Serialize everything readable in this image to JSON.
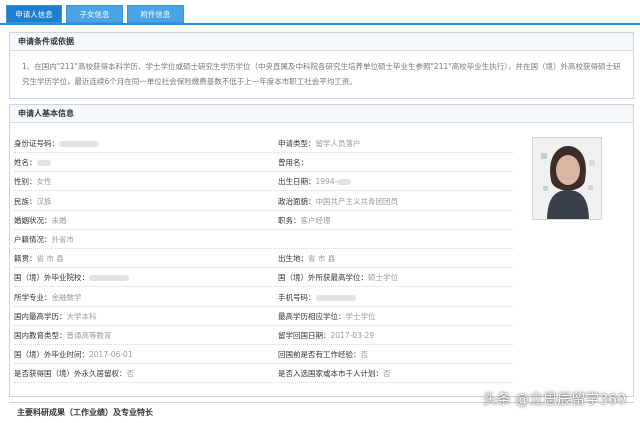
{
  "tabs": [
    {
      "label": "申请人信息"
    },
    {
      "label": "子女信息"
    },
    {
      "label": "附件信息"
    }
  ],
  "conditions": {
    "title": "申请条件或依据",
    "text": "1、在国内\"211\"高校获得本科学历、学士学位或硕士研究生学历学位（中央直属及中科院各研究生培养单位硕士毕业生参照\"211\"高校毕业生执行），并在国（境）外高校获得硕士研究生学历学位，最近连续6个月在同一单位社会保险缴费基数不低于上一年度本市职工社会平均工资。"
  },
  "basic_info": {
    "title": "申请人基本信息",
    "rows": [
      {
        "l1": "身份证号码：",
        "v1": "",
        "l2": "申请类型：",
        "v2": "留学人员落户"
      },
      {
        "l1": "姓名：",
        "v1": "",
        "l2": "曾用名：",
        "v2": ""
      },
      {
        "l1": "性别：",
        "v1": "女性",
        "l2": "出生日期：",
        "v2": "1994-"
      },
      {
        "l1": "民族：",
        "v1": "汉族",
        "l2": "政治面貌：",
        "v2": "中国共产主义共青团团员"
      },
      {
        "l1": "婚姻状况：",
        "v1": "未婚",
        "l2": "职务：",
        "v2": "客户经理"
      },
      {
        "l1": "户籍情况：",
        "v1": "外省市",
        "l2": "",
        "v2": ""
      },
      {
        "l1": "籍贯：",
        "v1": "省  市  县",
        "l2": "出生地：",
        "v2": "省  市  县"
      },
      {
        "l1": "国（境）外毕业院校：",
        "v1": "",
        "l2": "国（境）外所获最高学位：",
        "v2": "硕士学位"
      },
      {
        "l1": "所学专业：",
        "v1": "金融数学",
        "l2": "手机号码：",
        "v2": ""
      },
      {
        "l1": "国内最高学历：",
        "v1": "大学本科",
        "l2": "最高学历相应学位：",
        "v2": "学士学位"
      },
      {
        "l1": "国内教育类型：",
        "v1": "普通高等教育",
        "l2": "留学回国日期：",
        "v2": "2017-03-29"
      },
      {
        "l1": "国（境）外毕业时间：",
        "v1": "2017-06-01",
        "l2": "回国前是否有工作经验：",
        "v2": "否"
      },
      {
        "l1": "是否获得国（境）外永久居留权：",
        "v1": "否",
        "l2": "是否入选国家或本市千人计划：",
        "v2": "否"
      }
    ]
  },
  "achievements": {
    "title": "主要科研成果（工作业绩）及专业特长"
  },
  "watermark": "头条 @立思辰留学360"
}
